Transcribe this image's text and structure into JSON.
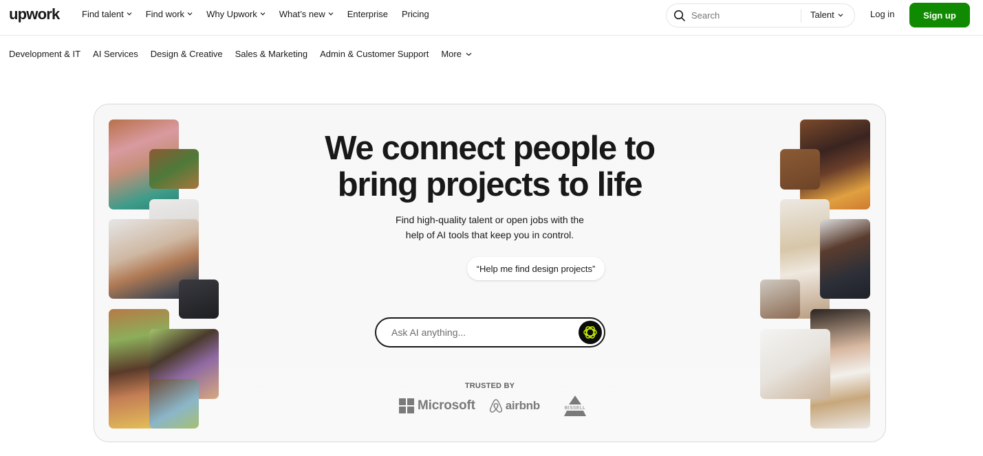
{
  "brand": {
    "logo_text": "upwork",
    "accent_color": "#108a00",
    "ai_accent_color": "#c8f000"
  },
  "topnav": {
    "items": [
      {
        "label": "Find talent",
        "has_dropdown": true
      },
      {
        "label": "Find work",
        "has_dropdown": true
      },
      {
        "label": "Why Upwork",
        "has_dropdown": true
      },
      {
        "label": "What’s new",
        "has_dropdown": true
      },
      {
        "label": "Enterprise",
        "has_dropdown": false
      },
      {
        "label": "Pricing",
        "has_dropdown": false
      }
    ],
    "search": {
      "placeholder": "Search",
      "scope": "Talent",
      "icon": "search-icon"
    },
    "login_label": "Log in",
    "signup_label": "Sign up"
  },
  "categories": {
    "items": [
      "Development & IT",
      "AI Services",
      "Design & Creative",
      "Sales & Marketing",
      "Admin & Customer Support"
    ],
    "more_label": "More"
  },
  "hero": {
    "headline_line1": "We connect people to",
    "headline_line2": "bring projects to life",
    "subtitle_line1": "Find high-quality talent or open jobs with the",
    "subtitle_line2": "help of AI tools that keep you in control.",
    "prompt_suggestion": "“Help me find design projects”",
    "ask_placeholder": "Ask AI anything...",
    "ai_button_icon": "ai-sparkle-icon",
    "trusted_by_label": "TRUSTED BY",
    "trusted_logos": [
      {
        "name": "Microsoft",
        "icon": "microsoft-logo"
      },
      {
        "name": "airbnb",
        "icon": "airbnb-logo"
      },
      {
        "name": "BISSELL",
        "icon": "bissell-logo"
      }
    ],
    "photos_left": [
      "woman-pink-hair-photo",
      "man-glasses-laptop-photo",
      "woman-phone-flowers-photo"
    ],
    "photos_right": [
      "woman-tablet-photo",
      "colleagues-meeting-photo",
      "woman-laptop-photo"
    ]
  }
}
